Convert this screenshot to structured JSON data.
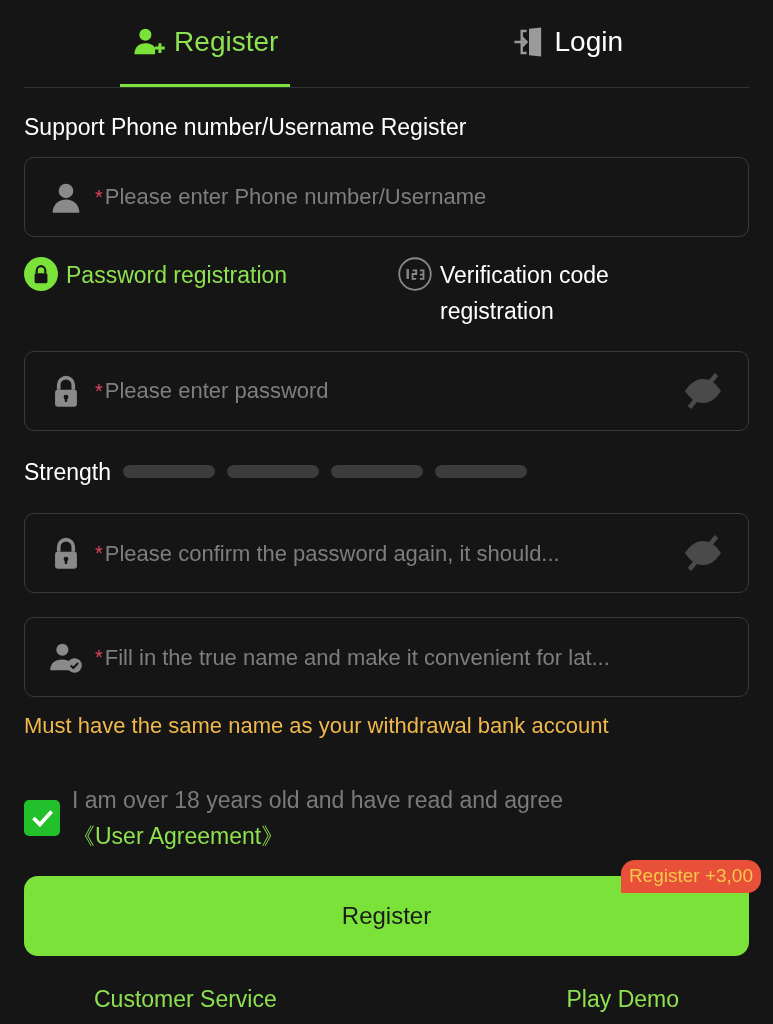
{
  "tabs": [
    {
      "label": "Register",
      "kind": "user-plus",
      "selected": true
    },
    {
      "label": "Login",
      "kind": "door",
      "selected": false
    }
  ],
  "heading": "Support Phone number/Username Register",
  "fields": [
    {
      "kind": "user",
      "marker": "*",
      "placeholder": "Please enter Phone number/Username",
      "eye": false
    },
    {
      "kind": "methods"
    },
    {
      "kind": "lock",
      "marker": "*",
      "placeholder": "Please enter password",
      "eye": true
    },
    {
      "kind": "strength"
    },
    {
      "kind": "lock",
      "marker": "*",
      "placeholder": "Please confirm the password again, it should...",
      "eye": true
    },
    {
      "kind": "user-check",
      "marker": "*",
      "placeholder": "Fill in the true name and make it convenient for lat...",
      "eye": false
    }
  ],
  "methods": [
    {
      "label": "Password registration",
      "kind": "lock",
      "selected": true
    },
    {
      "label": "Verification code registration",
      "kind": "digits",
      "selected": false
    }
  ],
  "strength": {
    "label": "Strength"
  },
  "name_hint": "Must have the same name as your withdrawal bank account",
  "agreement": {
    "checked": true,
    "text": "I am over 18 years old and have read and agree",
    "link": "《User Agreement》"
  },
  "register_button": {
    "label": "Register",
    "badge": "Register +3,00"
  },
  "footer_links": [
    "Customer Service",
    "Play Demo"
  ]
}
